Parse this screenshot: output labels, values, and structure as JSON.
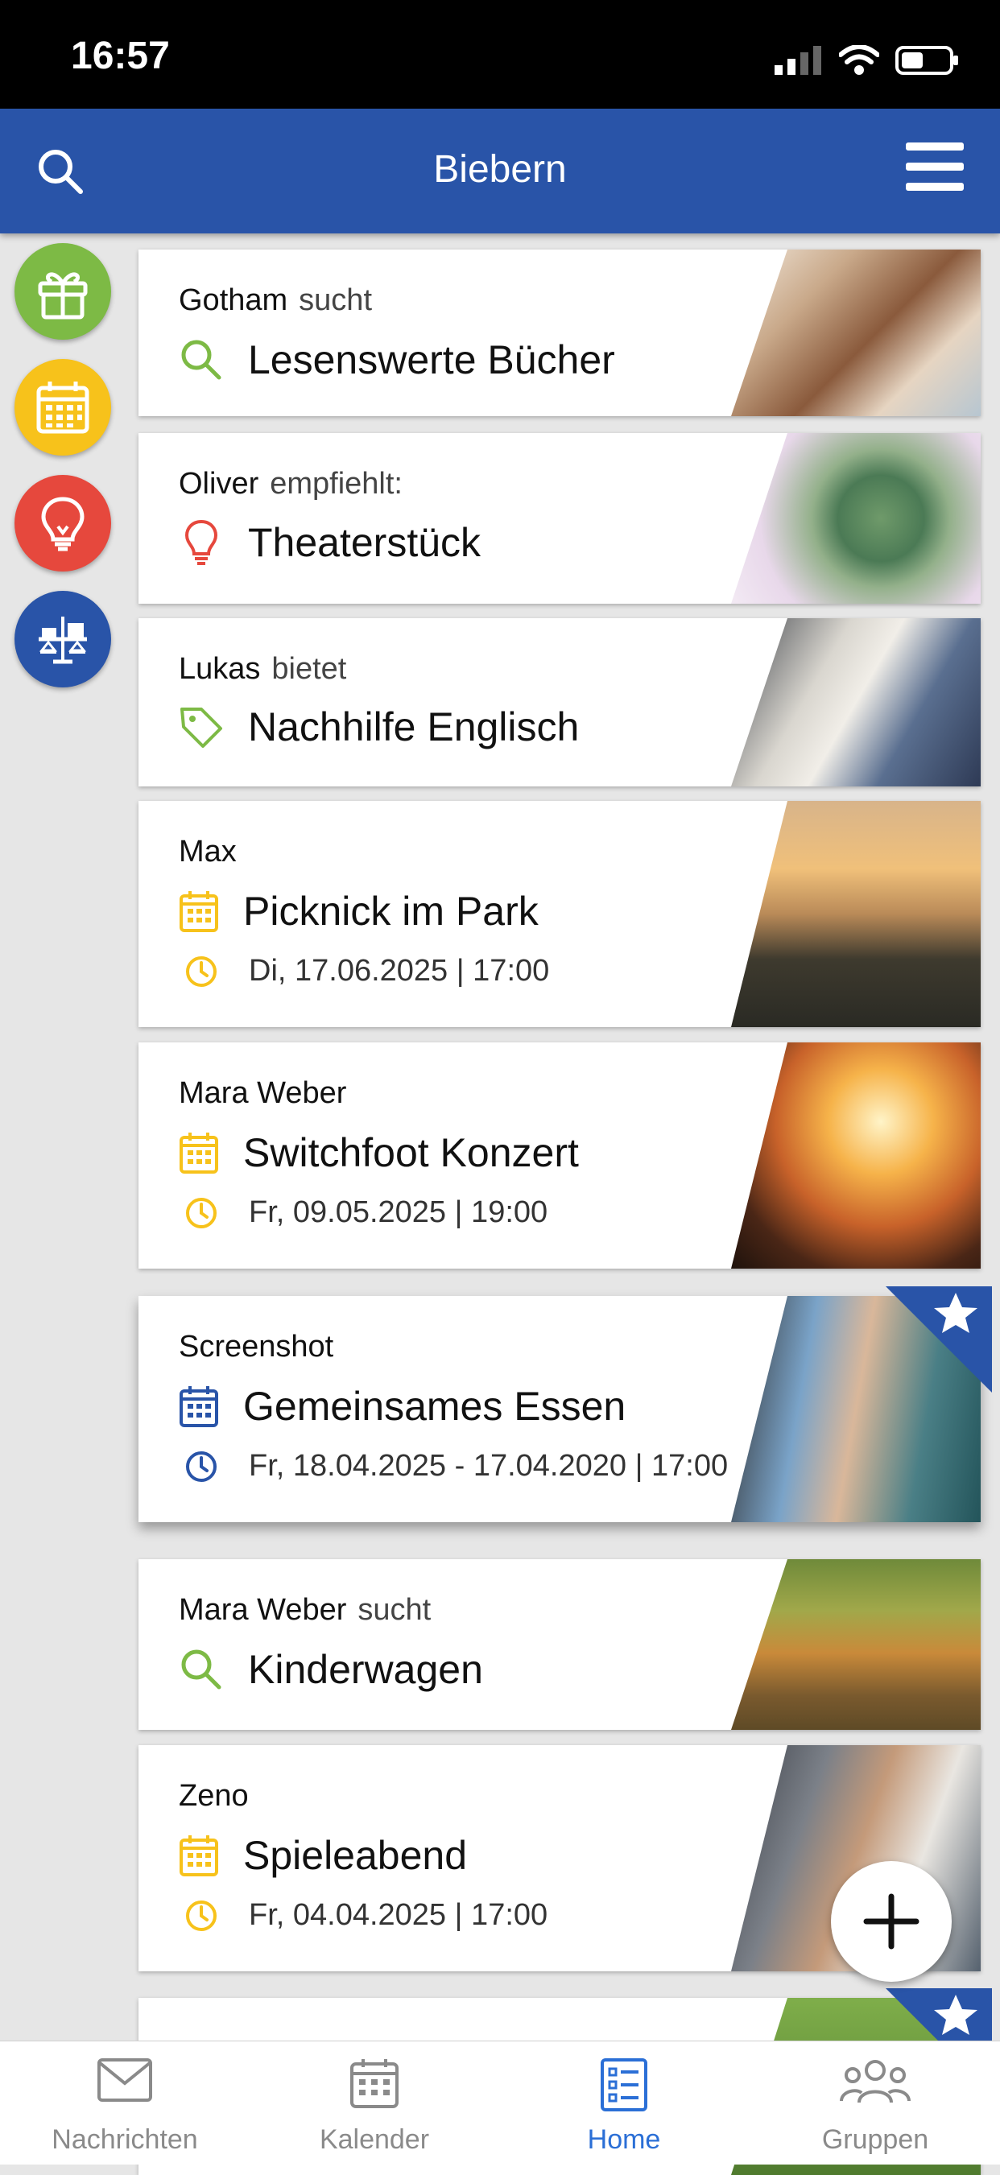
{
  "status": {
    "time": "16:57"
  },
  "header": {
    "title": "Biebern"
  },
  "cards": [
    {
      "author": "Gotham",
      "verb": "sucht",
      "title": "Lesenswerte Bücher"
    },
    {
      "author": "Oliver",
      "verb": "empfiehlt:",
      "title": "Theaterstück"
    },
    {
      "author": "Lukas",
      "verb": "bietet",
      "title": "Nachhilfe Englisch"
    },
    {
      "author": "Max",
      "verb": "",
      "title": "Picknick im Park",
      "date": "Di, 17.06.2025 | 17:00"
    },
    {
      "author": "Mara Weber",
      "verb": "",
      "title": "Switchfoot Konzert",
      "date": "Fr, 09.05.2025 | 19:00"
    },
    {
      "author": "Screenshot",
      "verb": "",
      "title": "Gemeinsames Essen",
      "date": "Fr, 18.04.2025 - 17.04.2020 | 17:00"
    },
    {
      "author": "Mara Weber",
      "verb": "sucht",
      "title": "Kinderwagen"
    },
    {
      "author": "Zeno",
      "verb": "",
      "title": "Spieleabend",
      "date": "Fr, 04.04.2025 | 17:00"
    }
  ],
  "tabs": [
    {
      "label": "Nachrichten"
    },
    {
      "label": "Kalender"
    },
    {
      "label": "Home"
    },
    {
      "label": "Gruppen"
    }
  ],
  "colors": {
    "primary": "#2954a8",
    "green": "#7dba45",
    "yellow": "#f7c21b",
    "red": "#e6483d",
    "active_tab": "#2b6fd6"
  }
}
